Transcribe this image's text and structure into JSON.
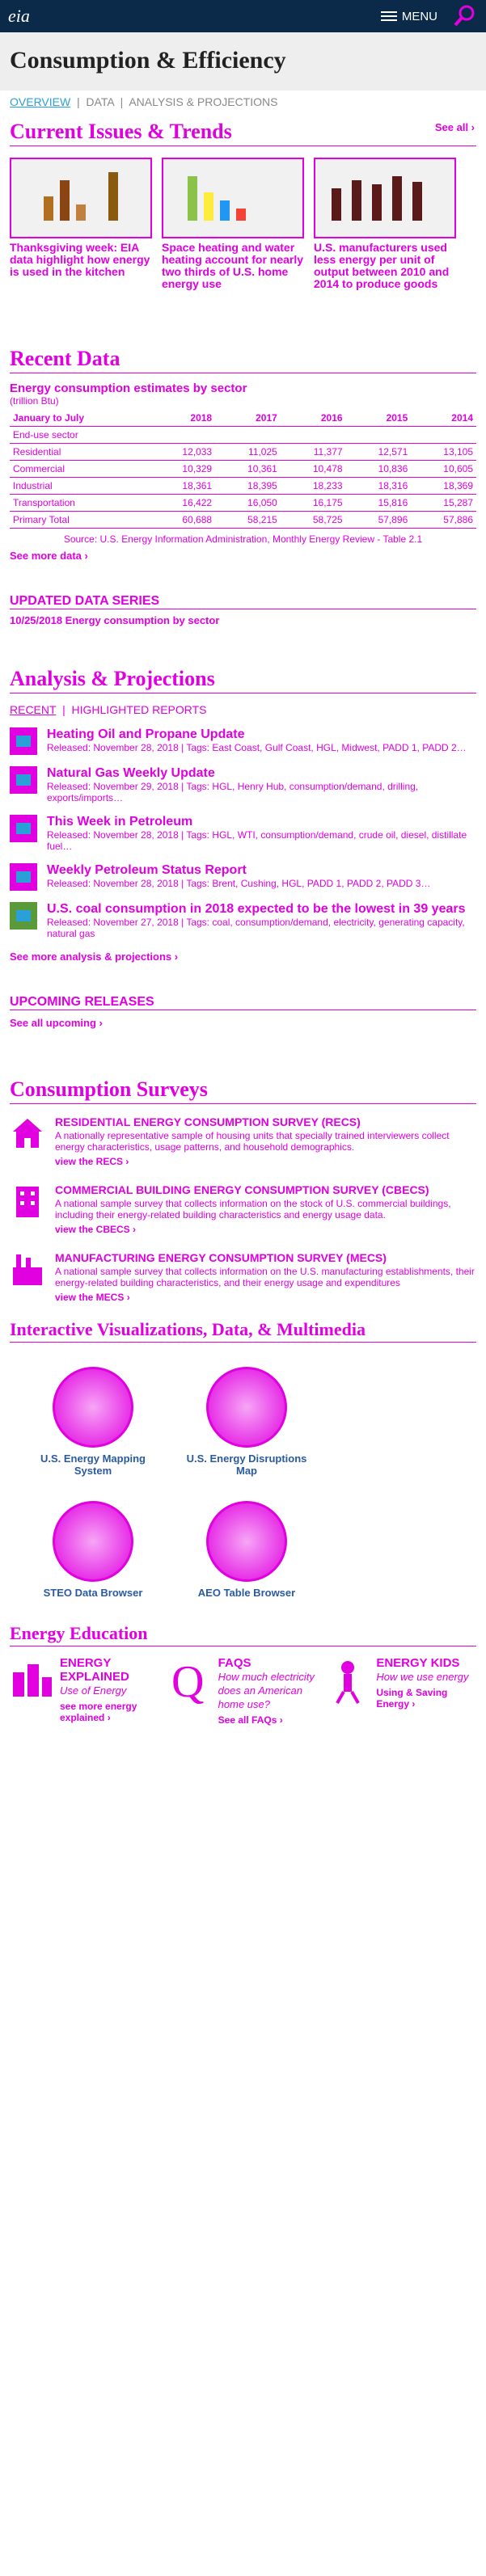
{
  "header": {
    "logo": "eia",
    "menu_label": "MENU"
  },
  "page_title": "Consumption & Efficiency",
  "subnav": [
    "OVERVIEW",
    "DATA",
    "ANALYSIS & PROJECTIONS"
  ],
  "trends": {
    "heading": "Current Issues & Trends",
    "see_all": "See all ›",
    "items": [
      {
        "title": "Thanksgiving week: EIA data highlight how energy is used in the kitchen"
      },
      {
        "title": "Space heating and water heating account for nearly two thirds of U.S. home energy use"
      },
      {
        "title": "U.S. manufacturers used less energy per unit of output between 2010 and 2014 to produce goods"
      }
    ]
  },
  "recent_data": {
    "heading": "Recent Data",
    "table_title": "Energy consumption estimates by sector",
    "units": "(trillion Btu)",
    "columns": [
      "January to July",
      "2018",
      "2017",
      "2016",
      "2015",
      "2014"
    ],
    "subheading": "End-use sector",
    "rows": [
      {
        "label": "Residential",
        "values": [
          "12,033",
          "11,025",
          "11,377",
          "12,571",
          "13,105"
        ]
      },
      {
        "label": "Commercial",
        "values": [
          "10,329",
          "10,361",
          "10,478",
          "10,836",
          "10,605"
        ]
      },
      {
        "label": "Industrial",
        "values": [
          "18,361",
          "18,395",
          "18,233",
          "18,316",
          "18,369"
        ]
      },
      {
        "label": "Transportation",
        "values": [
          "16,422",
          "16,050",
          "16,175",
          "15,816",
          "15,287"
        ]
      },
      {
        "label": "Primary Total",
        "values": [
          "60,688",
          "58,215",
          "58,725",
          "57,896",
          "57,886"
        ]
      }
    ],
    "source": "Source: U.S. Energy Information Administration, Monthly Energy Review - Table 2.1",
    "see_more": "See more data ›"
  },
  "updated_series": {
    "heading": "UPDATED DATA SERIES",
    "entry": "10/25/2018   Energy consumption by sector"
  },
  "analysis": {
    "heading": "Analysis & Projections",
    "tabs": [
      "RECENT",
      "HIGHLIGHTED REPORTS"
    ],
    "items": [
      {
        "title": "Heating Oil and Propane Update",
        "meta": "Released: November 28, 2018 | Tags: East Coast, Gulf Coast, HGL, Midwest, PADD 1, PADD 2…"
      },
      {
        "title": "Natural Gas Weekly Update",
        "meta": "Released: November 29, 2018 | Tags: HGL, Henry Hub, consumption/demand, drilling, exports/imports…"
      },
      {
        "title": "This Week in Petroleum",
        "meta": "Released: November 28, 2018 | Tags: HGL, WTI, consumption/demand, crude oil, diesel, distillate fuel…"
      },
      {
        "title": "Weekly Petroleum Status Report",
        "meta": "Released: November 28, 2018 | Tags: Brent, Cushing, HGL, PADD 1, PADD 2, PADD 3…"
      },
      {
        "title": "U.S. coal consumption in 2018 expected to be the lowest in 39 years",
        "meta": "Released: November 27, 2018 | Tags: coal, consumption/demand, electricity, generating capacity, natural gas"
      }
    ],
    "see_more": "See more analysis & projections ›"
  },
  "upcoming": {
    "heading": "UPCOMING RELEASES",
    "see_all": "See all upcoming ›"
  },
  "surveys": {
    "heading": "Consumption Surveys",
    "items": [
      {
        "title": "RESIDENTIAL ENERGY CONSUMPTION SURVEY (RECS)",
        "desc": "A nationally representative sample of housing units that specially trained interviewers collect energy characteristics, usage patterns, and household demographics.",
        "link": "view the RECS ›"
      },
      {
        "title": "COMMERCIAL BUILDING ENERGY CONSUMPTION SURVEY (CBECS)",
        "desc": "A national sample survey that collects information on the stock of U.S. commercial buildings, including their energy-related building characteristics and energy usage data.",
        "link": "view the CBECS ›"
      },
      {
        "title": "MANUFACTURING ENERGY CONSUMPTION SURVEY (MECS)",
        "desc": "A national sample survey that collects information on the U.S. manufacturing establishments, their energy-related building characteristics, and their energy usage and expenditures",
        "link": "view the MECS ›"
      }
    ]
  },
  "multimedia": {
    "heading": "Interactive Visualizations, Data, & Multimedia",
    "items": [
      "U.S. Energy Mapping System",
      "U.S. Energy Disruptions Map",
      "STEO Data Browser",
      "AEO Table Browser"
    ]
  },
  "education": {
    "heading": "Energy Education",
    "cols": [
      {
        "title": "ENERGY EXPLAINED",
        "sub": "Use of Energy",
        "link": "see more energy explained ›"
      },
      {
        "title": "FAQS",
        "sub": "How much electricity does an American home use?",
        "link": "See all FAQs ›"
      },
      {
        "title": "ENERGY KIDS",
        "sub": "How we use energy",
        "link": "Using & Saving Energy ›"
      }
    ]
  }
}
